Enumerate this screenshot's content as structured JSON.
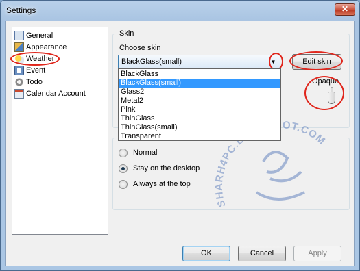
{
  "window": {
    "title": "Settings",
    "close_glyph": "✕"
  },
  "nav": {
    "items": [
      {
        "label": "General",
        "icon": "general-icon"
      },
      {
        "label": "Appearance",
        "icon": "appearance-icon"
      },
      {
        "label": "Weather",
        "icon": "weather-icon"
      },
      {
        "label": "Event",
        "icon": "event-icon"
      },
      {
        "label": "Todo",
        "icon": "todo-icon"
      },
      {
        "label": "Calendar Account",
        "icon": "calendar-icon"
      }
    ]
  },
  "skin": {
    "group_title": "Skin",
    "choose_label": "Choose skin",
    "selected": "BlackGlass(small)",
    "edit_button": "Edit skin",
    "opaque_label": "Opaque",
    "options": [
      {
        "label": "BlackGlass",
        "selected": false
      },
      {
        "label": "BlackGlass(small)",
        "selected": true
      },
      {
        "label": "Glass2",
        "selected": false
      },
      {
        "label": "Metal2",
        "selected": false
      },
      {
        "label": "Pink",
        "selected": false
      },
      {
        "label": "ThinGlass",
        "selected": false
      },
      {
        "label": "ThinGlass(small)",
        "selected": false
      },
      {
        "label": "Transparent",
        "selected": false
      }
    ]
  },
  "position": {
    "options": [
      {
        "label": "Normal",
        "checked": false
      },
      {
        "label": "Stay on the desktop",
        "checked": true
      },
      {
        "label": "Always at the top",
        "checked": false
      }
    ]
  },
  "footer": {
    "ok": "OK",
    "cancel": "Cancel",
    "apply": "Apply"
  },
  "watermark": {
    "url_text": "SHARH4PC.BLOGSPOT.COM"
  },
  "colors": {
    "selection": "#3399ff",
    "annotation": "#e0261c",
    "watermark": "#4a6fb5"
  }
}
